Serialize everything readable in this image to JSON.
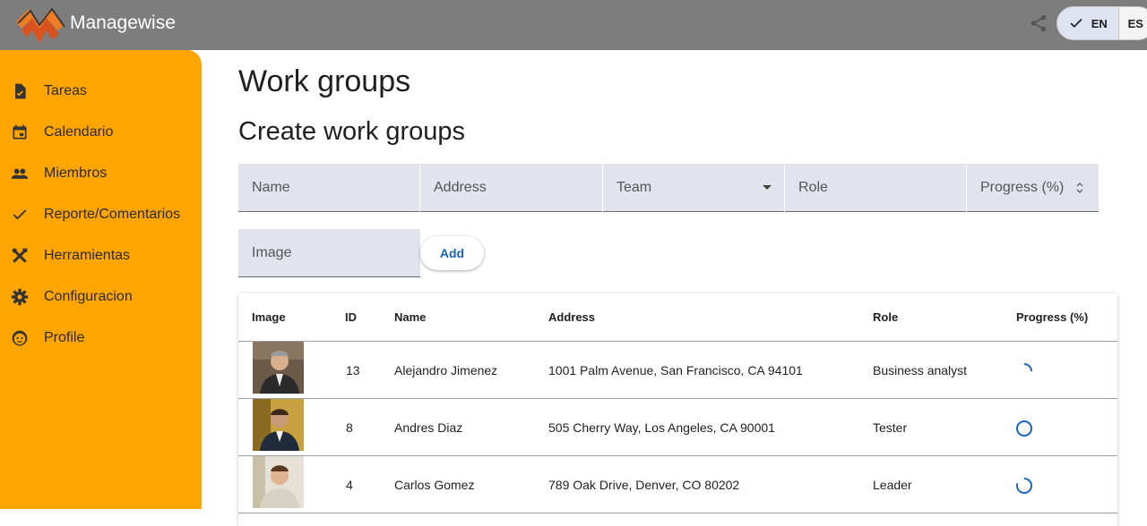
{
  "header": {
    "app_title": "Managewise",
    "share_icon": "share-icon",
    "languages": [
      "EN",
      "ES"
    ],
    "selected_language": "EN"
  },
  "sidebar": {
    "items": [
      {
        "label": "Tareas",
        "icon": "task-icon"
      },
      {
        "label": "Calendario",
        "icon": "calendar-icon"
      },
      {
        "label": "Miembros",
        "icon": "people-icon"
      },
      {
        "label": "Reporte/Comentarios",
        "icon": "check-icon"
      },
      {
        "label": "Herramientas",
        "icon": "tools-icon"
      },
      {
        "label": "Configuracion",
        "icon": "gear-icon"
      },
      {
        "label": "Profile",
        "icon": "face-icon"
      }
    ]
  },
  "main": {
    "title": "Work groups",
    "subtitle": "Create work groups"
  },
  "form": {
    "name_label": "Name",
    "address_label": "Address",
    "team_label": "Team",
    "role_label": "Role",
    "progress_label": "Progress (%)",
    "image_label": "Image",
    "add_label": "Add"
  },
  "table": {
    "columns": [
      "Image",
      "ID",
      "Name",
      "Address",
      "Role",
      "Progress (%)"
    ],
    "rows": [
      {
        "id": "13",
        "name": "Alejandro Jimenez",
        "address": "1001 Palm Avenue, San Francisco, CA 94101",
        "role": "Business analyst",
        "progress": 0.25
      },
      {
        "id": "8",
        "name": "Andres Diaz",
        "address": "505 Cherry Way, Los Angeles, CA 90001",
        "role": "Tester",
        "progress": 1.0
      },
      {
        "id": "4",
        "name": "Carlos Gomez",
        "address": "789 Oak Drive, Denver, CO 80202",
        "role": "Leader",
        "progress": 0.8
      }
    ]
  },
  "colors": {
    "topbar": "#7d7d7d",
    "sidebar": "#ffa500",
    "accent": "#1565c0",
    "field_bg": "#e2e4ed"
  }
}
